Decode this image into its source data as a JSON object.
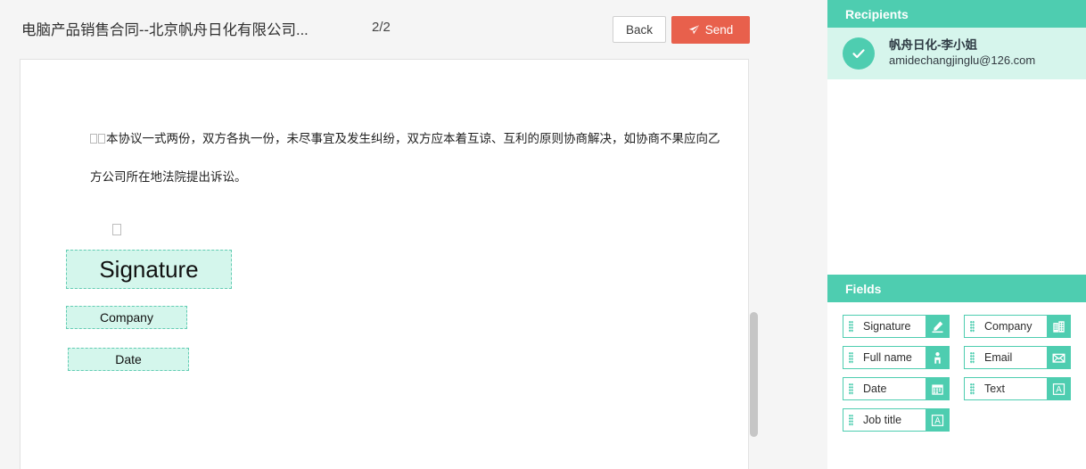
{
  "toolbar": {
    "doc_title": "电脑产品销售合同--北京帆舟日化有限公司...",
    "page_counter": "2/2",
    "back_label": "Back",
    "send_label": "Send",
    "send_icon": "paper-plane-icon",
    "send_color": "#e8604c"
  },
  "document": {
    "paragraph_1": "本协议一式两份，双方各执一份，未尽事宜及发生纠纷，双方应本着互谅、互利的原则协商解决，如协商不果应向乙",
    "paragraph_2": "方公司所在地法院提出诉讼。",
    "placed_fields": [
      {
        "label": "Signature",
        "type": "signature"
      },
      {
        "label": "Company",
        "type": "company"
      },
      {
        "label": "Date",
        "type": "date"
      }
    ]
  },
  "sidebar": {
    "accent_color": "#4ecdb0",
    "recipients": {
      "title": "Recipients",
      "items": [
        {
          "name": "帆舟日化-李小姐",
          "email": "amidechangjinglu@126.com",
          "status_icon": "check-icon"
        }
      ]
    },
    "fields": {
      "title": "Fields",
      "items": [
        {
          "label": "Signature",
          "icon": "signature-pen-icon"
        },
        {
          "label": "Company",
          "icon": "building-icon"
        },
        {
          "label": "Full name",
          "icon": "person-icon"
        },
        {
          "label": "Email",
          "icon": "envelope-icon"
        },
        {
          "label": "Date",
          "icon": "calendar-icon"
        },
        {
          "label": "Text",
          "icon": "text-a-icon"
        },
        {
          "label": "Job title",
          "icon": "text-a-icon"
        }
      ]
    }
  }
}
